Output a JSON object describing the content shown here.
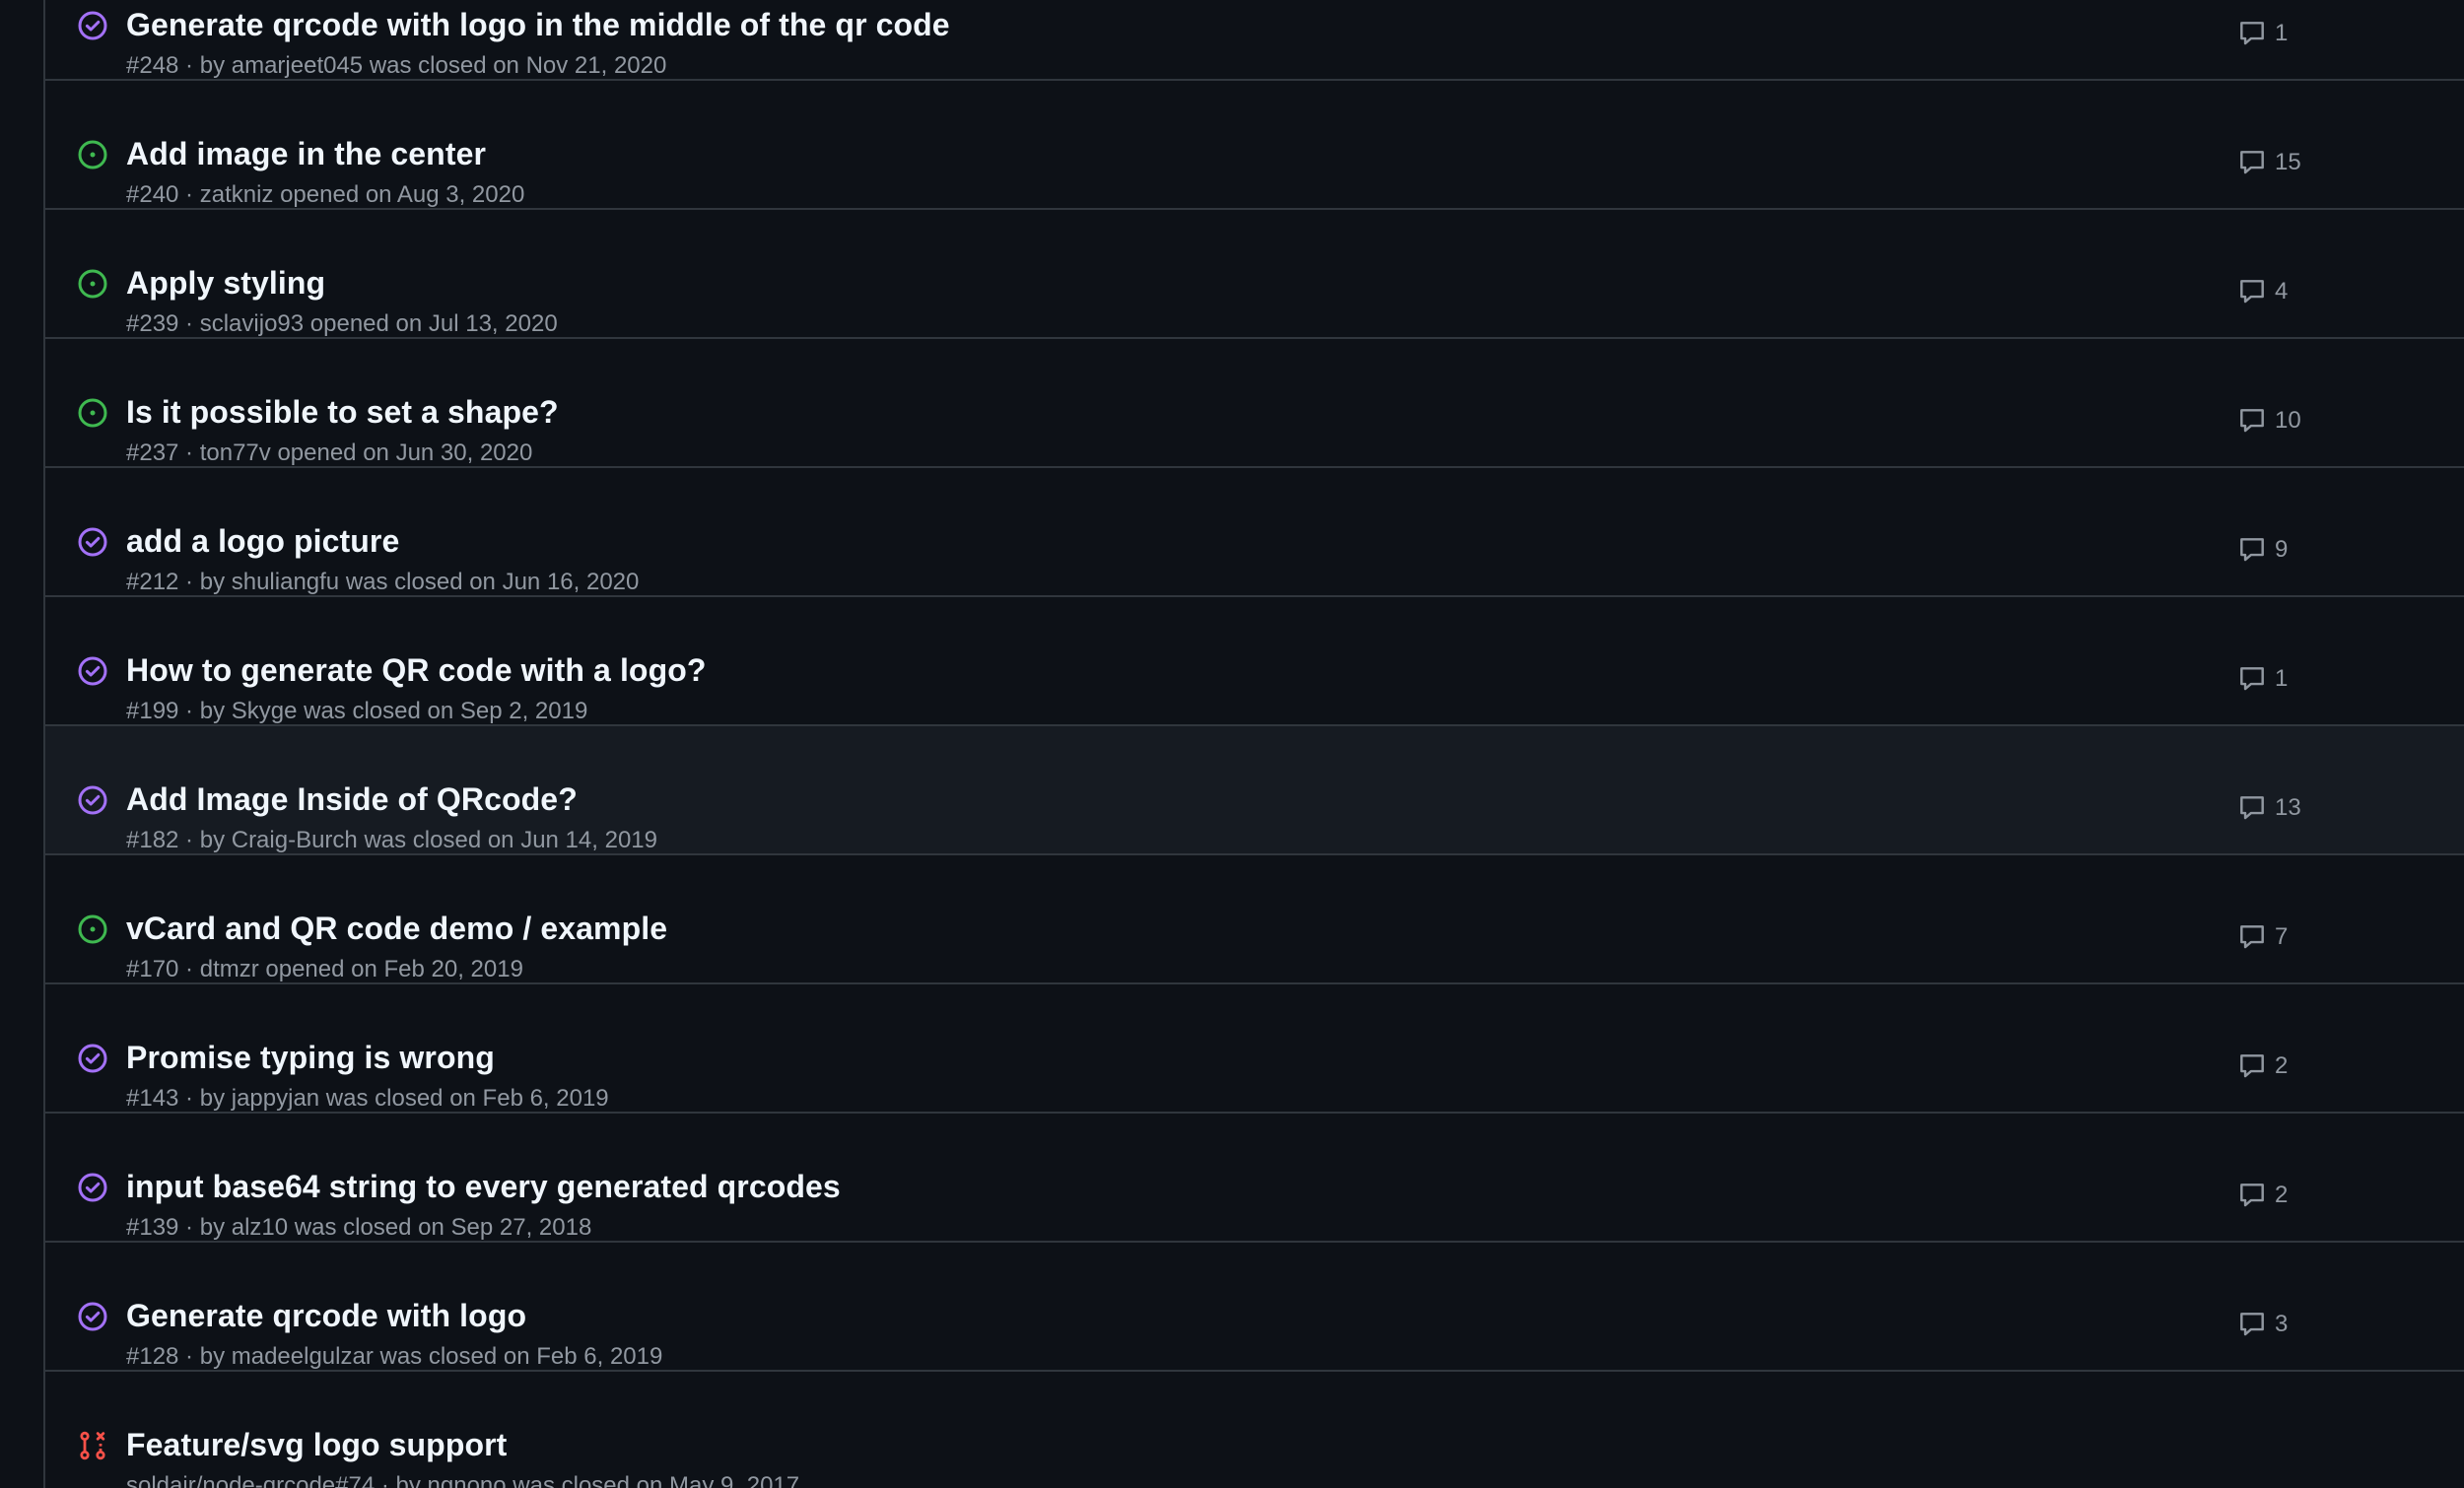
{
  "colors": {
    "background": "#0d1117",
    "row_hover": "#161b22",
    "border": "#30363d",
    "title": "#f0f6fc",
    "meta": "#9198a1",
    "open": "#3fb950",
    "closed": "#a371f7",
    "pr_closed": "#f85149"
  },
  "issues": [
    {
      "title": "Generate qrcode with logo in the middle of the qr code",
      "meta": "#248 · by amarjeet045 was closed on Nov 21, 2020",
      "comments": "1",
      "state_icon": "issue-closed-icon"
    },
    {
      "title": "Add image in the center",
      "meta": "#240 · zatkniz opened on Aug 3, 2020",
      "comments": "15",
      "state_icon": "issue-opened-icon"
    },
    {
      "title": "Apply styling",
      "meta": "#239 · sclavijo93 opened on Jul 13, 2020",
      "comments": "4",
      "state_icon": "issue-opened-icon"
    },
    {
      "title": "Is it possible to set a shape?",
      "meta": "#237 · ton77v opened on Jun 30, 2020",
      "comments": "10",
      "state_icon": "issue-opened-icon"
    },
    {
      "title": "add a logo picture",
      "meta": "#212 · by shuliangfu was closed on Jun 16, 2020",
      "comments": "9",
      "state_icon": "issue-closed-icon"
    },
    {
      "title": "How to generate QR code with a logo?",
      "meta": "#199 · by Skyge was closed on Sep 2, 2019",
      "comments": "1",
      "state_icon": "issue-closed-icon"
    },
    {
      "title": "Add Image Inside of QRcode?",
      "meta": "#182 · by Craig-Burch was closed on Jun 14, 2019",
      "comments": "13",
      "state_icon": "issue-closed-icon"
    },
    {
      "title": "vCard and QR code demo / example",
      "meta": "#170 · dtmzr opened on Feb 20, 2019",
      "comments": "7",
      "state_icon": "issue-opened-icon"
    },
    {
      "title": "Promise typing is wrong",
      "meta": "#143 · by jappyjan was closed on Feb 6, 2019",
      "comments": "2",
      "state_icon": "issue-closed-icon"
    },
    {
      "title": "input base64 string to every generated qrcodes",
      "meta": "#139 · by alz10 was closed on Sep 27, 2018",
      "comments": "2",
      "state_icon": "issue-closed-icon"
    },
    {
      "title": "Generate qrcode with logo",
      "meta": "#128 · by madeelgulzar was closed on Feb 6, 2019",
      "comments": "3",
      "state_icon": "issue-closed-icon"
    },
    {
      "title": "Feature/svg logo support",
      "meta": "soldair/node-qrcode#74 · by ngnono was closed on May 9, 2017",
      "comments": "",
      "state_icon": "pull-request-closed-icon"
    }
  ]
}
